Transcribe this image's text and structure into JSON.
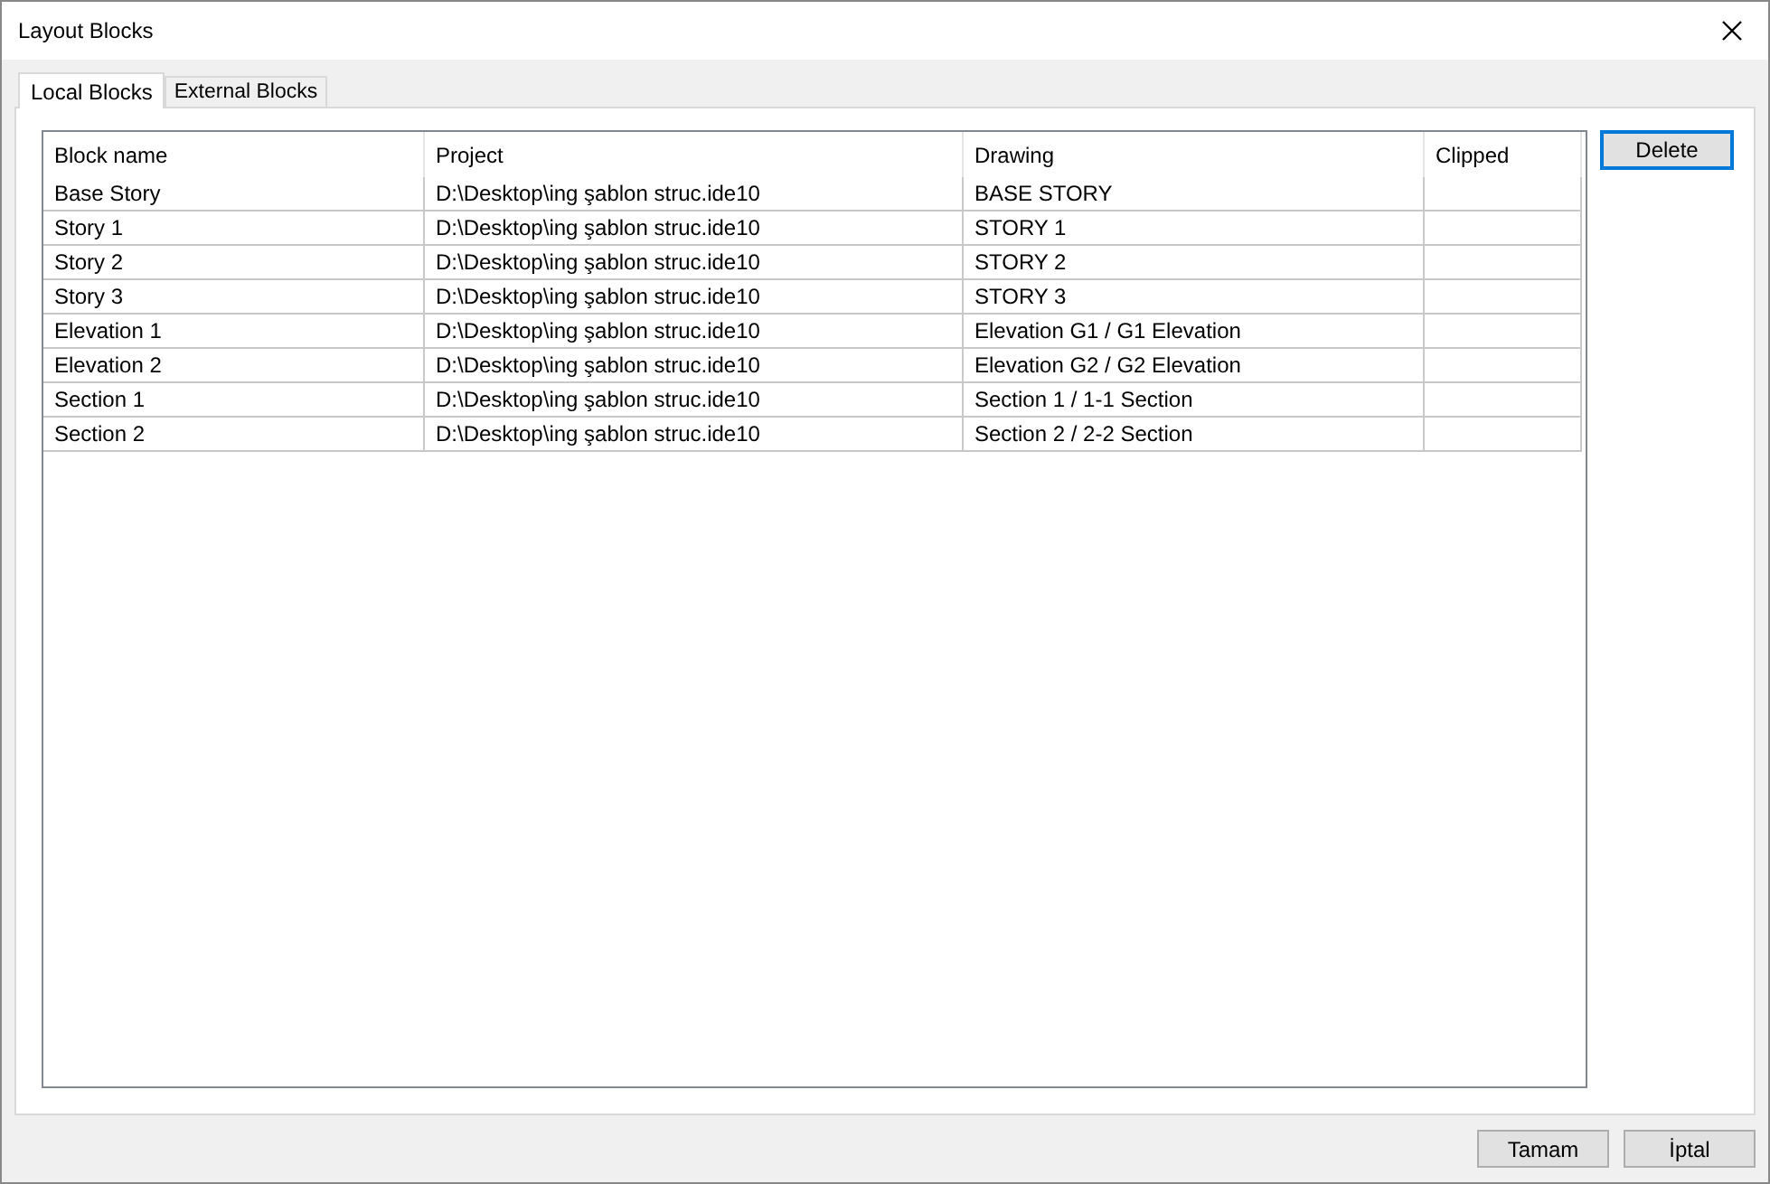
{
  "window": {
    "title": "Layout Blocks"
  },
  "tabs": [
    {
      "label": "Local Blocks",
      "selected": true
    },
    {
      "label": "External Blocks",
      "selected": false
    }
  ],
  "table": {
    "columns": [
      "Block name",
      "Project",
      "Drawing",
      "Clipped"
    ],
    "rows": [
      [
        "Base Story",
        "D:\\Desktop\\ing şablon struc.ide10",
        "BASE STORY"
      ],
      [
        "Story 1",
        "D:\\Desktop\\ing şablon struc.ide10",
        "STORY 1"
      ],
      [
        "Story 2",
        "D:\\Desktop\\ing şablon struc.ide10",
        "STORY 2"
      ],
      [
        "Story 3",
        "D:\\Desktop\\ing şablon struc.ide10",
        "STORY 3"
      ],
      [
        "Elevation 1",
        "D:\\Desktop\\ing şablon struc.ide10",
        "Elevation G1 / G1 Elevation"
      ],
      [
        "Elevation 2",
        "D:\\Desktop\\ing şablon struc.ide10",
        "Elevation G2 / G2 Elevation"
      ],
      [
        "Section 1",
        "D:\\Desktop\\ing şablon struc.ide10",
        "Section 1 / 1-1 Section"
      ],
      [
        "Section 2",
        "D:\\Desktop\\ing şablon struc.ide10",
        "Section 2 / 2-2 Section"
      ]
    ]
  },
  "side_buttons": [
    {
      "label": "Delete",
      "focused": true
    }
  ],
  "buttons": [
    "Tamam",
    "İptal"
  ]
}
